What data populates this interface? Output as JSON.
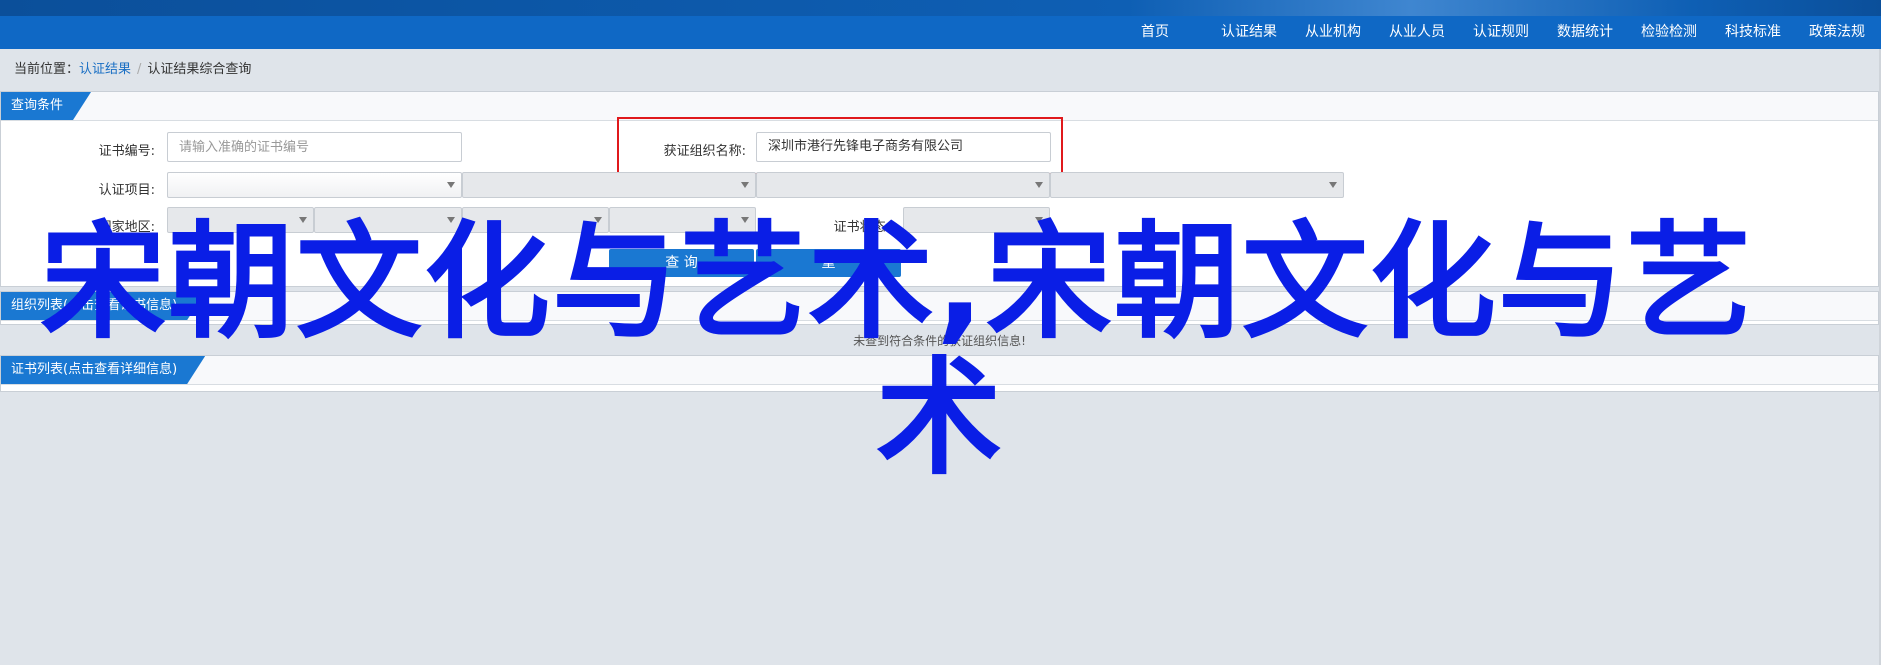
{
  "nav": {
    "items": [
      "首页",
      "认证结果",
      "从业机构",
      "从业人员",
      "认证规则",
      "数据统计",
      "检验检测",
      "科技标准",
      "政策法规"
    ]
  },
  "breadcrumb": {
    "prefix": "当前位置：",
    "link": "认证结果",
    "separator": "/",
    "current": "认证结果综合查询"
  },
  "query_panel": {
    "tab": "查询条件",
    "cert_no_label": "证书编号:",
    "cert_no_placeholder": "请输入准确的证书编号",
    "org_name_label": "获证组织名称:",
    "org_name_value": "深圳市港行先锋电子商务有限公司",
    "cert_item_label": "认证项目:",
    "country_label": "国家地区:",
    "cert_status_label": "证书状态:",
    "search_button": "查 询",
    "reset_button": "重"
  },
  "org_panel": {
    "tab": "组织列表(点击查看证书信息)",
    "empty_message": "未查到符合条件的获证组织信息!"
  },
  "cert_panel": {
    "tab": "证书列表(点击查看详细信息)"
  },
  "overlay": {
    "line1": "宋朝文化与艺术,宋朝文化与艺",
    "line2": "术"
  },
  "colors": {
    "nav_bg": "#0f68c5",
    "tab_bg": "#1a78d2",
    "highlight_border": "#e0191c",
    "overlay_text": "#0a1ee6"
  }
}
